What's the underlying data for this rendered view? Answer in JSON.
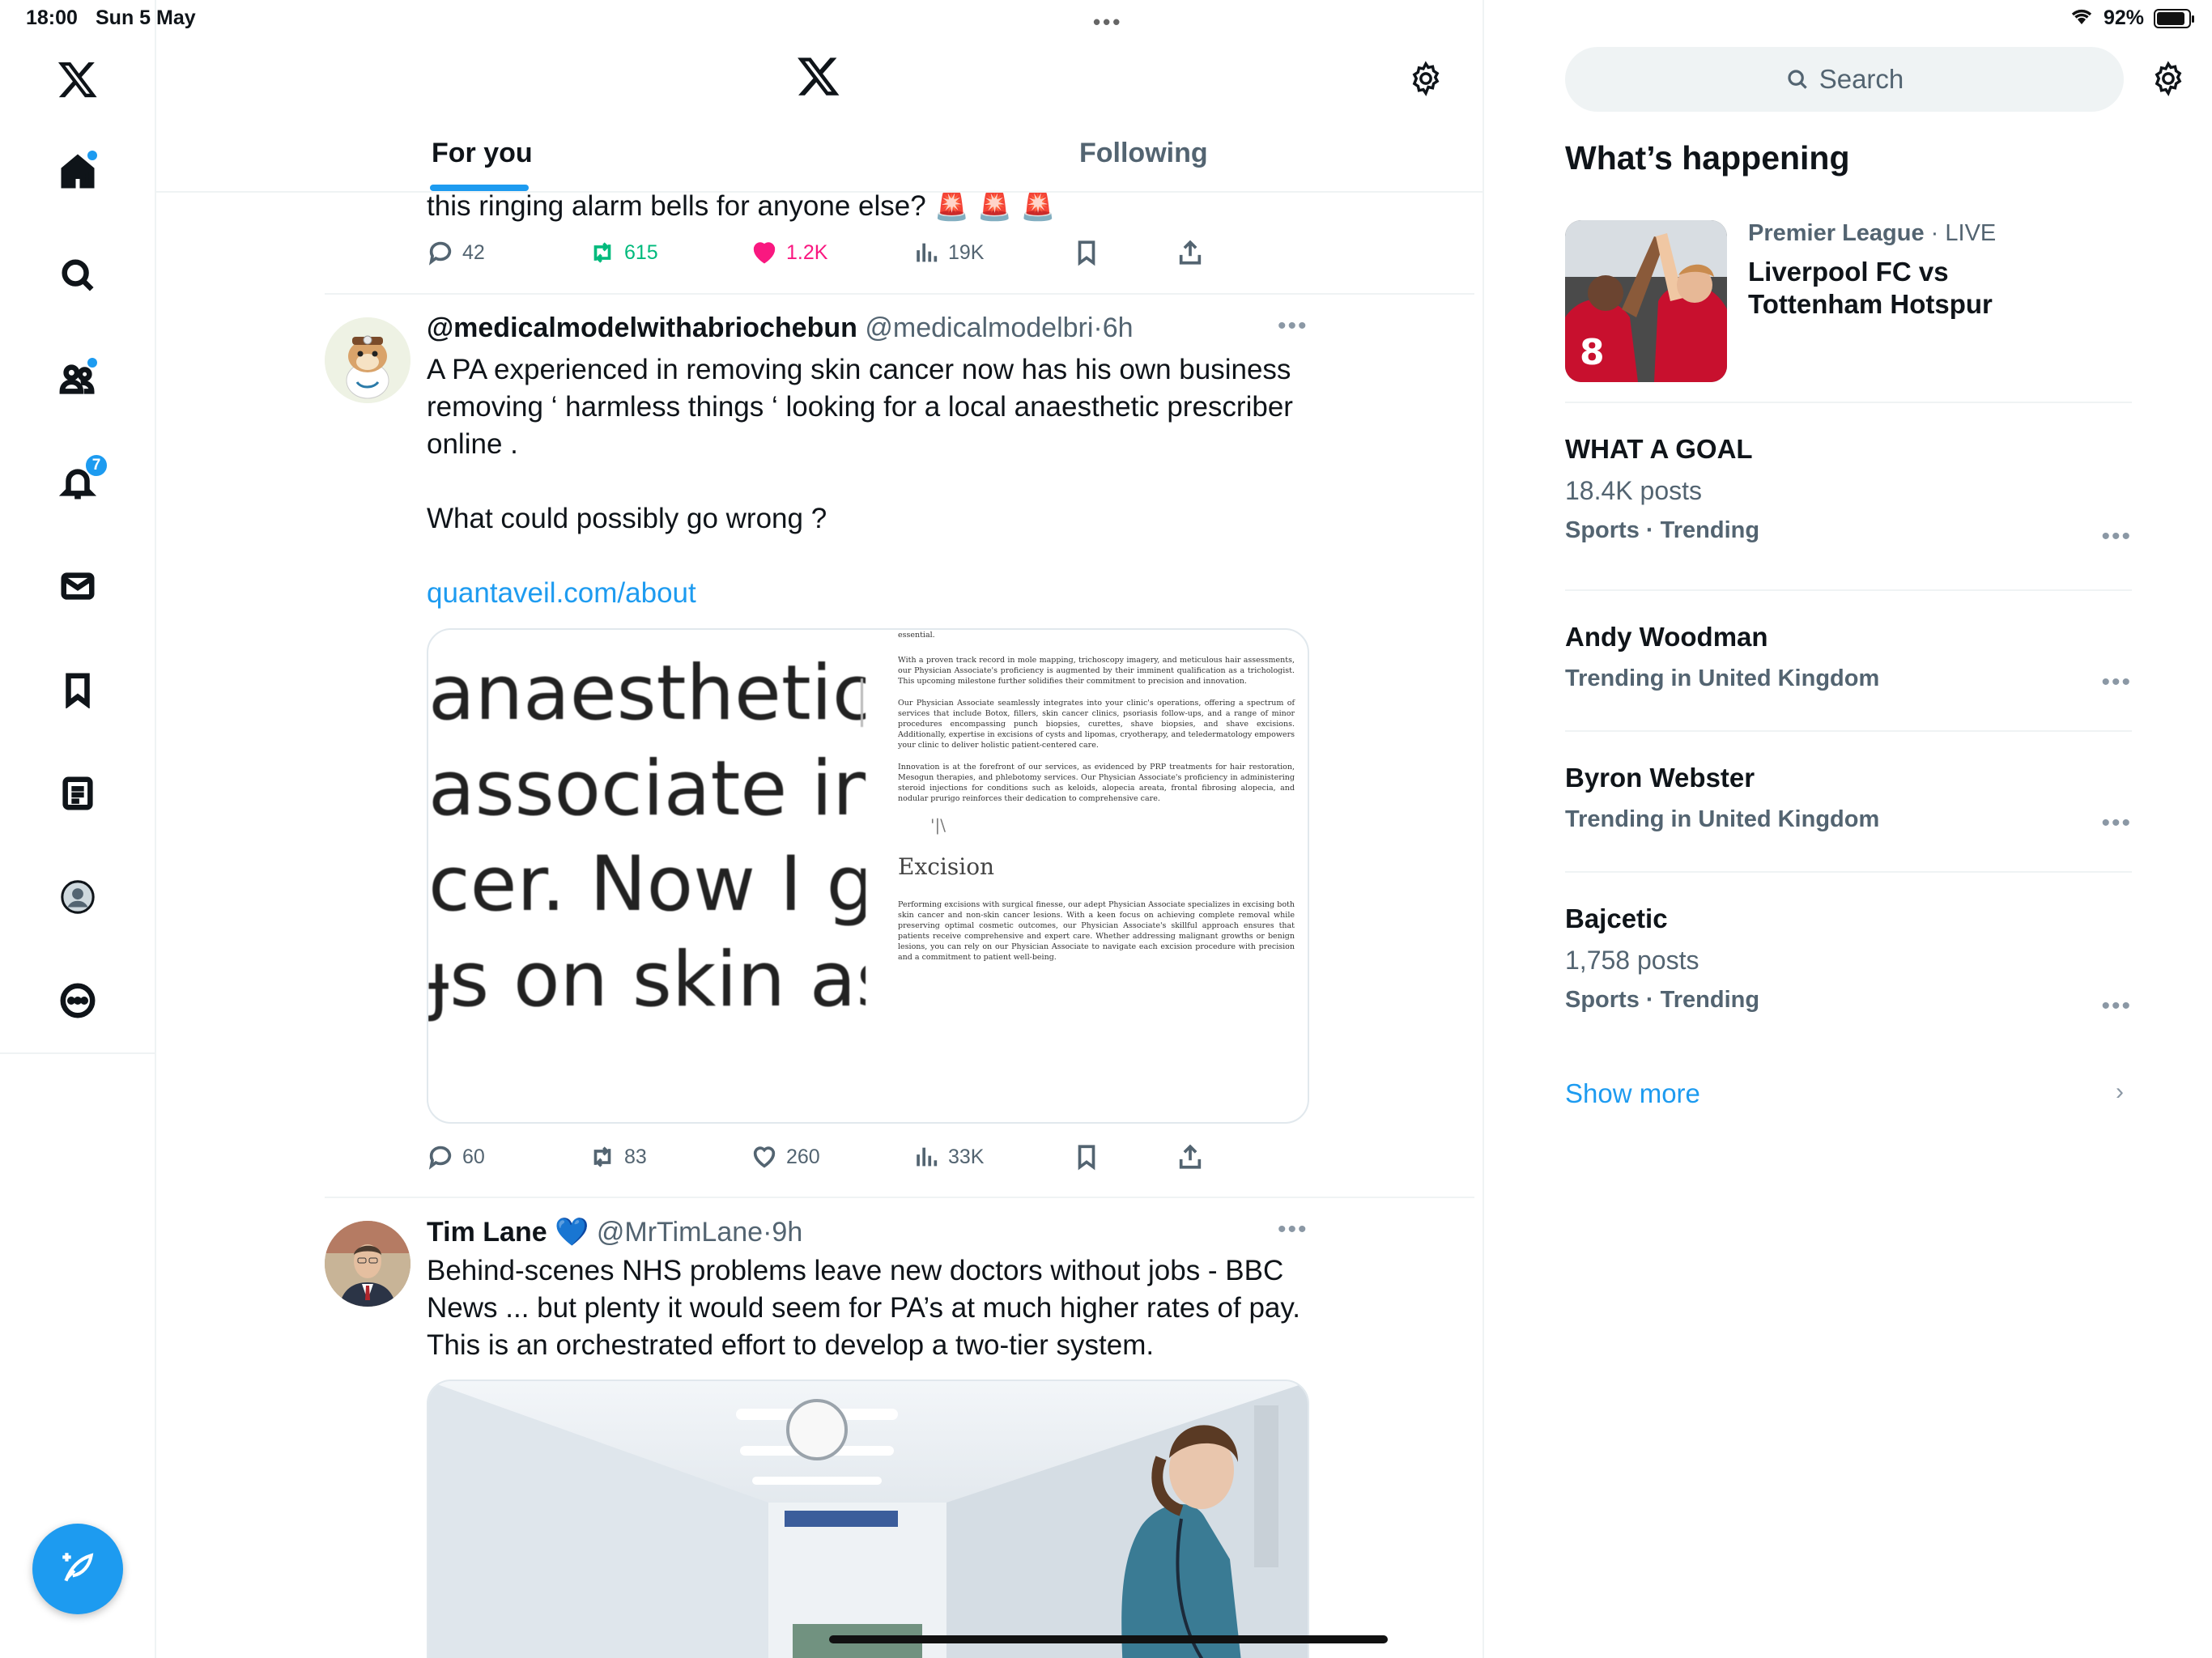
{
  "status_bar": {
    "time": "18:00",
    "date": "Sun 5 May",
    "battery": "92%"
  },
  "header": {
    "tabs": [
      {
        "label": "For you"
      },
      {
        "label": "Following"
      }
    ]
  },
  "nav": {
    "notifications_badge": "7"
  },
  "tweets": [
    {
      "text": "this ringing alarm bells for anyone else? 🚨 🚨 🚨",
      "replies": "42",
      "retweets": "615",
      "likes": "1.2K",
      "views": "19K"
    },
    {
      "name": "@medicalmodelwithabriochebun",
      "handle": "@medicalmodelbri",
      "time": "6h",
      "text_lines": [
        "A PA experienced in removing skin cancer now has his own business",
        "removing ‘ harmless things ‘ looking for a local anaesthetic prescriber",
        "online  .",
        "What could possibly go wrong ?"
      ],
      "link": "quantaveil.com/about",
      "image": {
        "big_lines": [
          "anaesthetic",
          "associate in",
          "cer. Now I gc",
          "ɟs on skin as"
        ],
        "doc_heading": "Excision",
        "doc_top": "essential.",
        "doc_p1": "With a proven track record in mole mapping, trichoscopy imagery, and meticulous hair assessments, our Physician Associate's proficiency is augmented by their imminent qualification as a trichologist. This upcoming milestone further solidifies their commitment to precision and innovation.",
        "doc_p2": "Our Physician Associate seamlessly integrates into your clinic's operations, offering a spectrum of services that include Botox, fillers, skin cancer clinics, psoriasis follow-ups, and a range of minor procedures encompassing punch biopsies, curettes, shave biopsies, and shave excisions. Additionally, expertise in excisions of cysts and lipomas, cryotherapy, and teledermatology empowers your clinic to deliver holistic patient-centered care.",
        "doc_p3": "Innovation is at the forefront of our services, as evidenced by PRP treatments for hair restoration, Mesogun therapies, and phlebotomy services. Our Physician Associate's proficiency in administering steroid injections for conditions such as keloids, alopecia areata, frontal fibrosing alopecia, and nodular prurigo reinforces their dedication to comprehensive care.",
        "doc_p4": "Performing excisions with surgical finesse, our adept Physician Associate specializes in excising both skin cancer and non-skin cancer lesions. With a keen focus on achieving complete removal while preserving optimal cosmetic outcomes, our Physician Associate's skillful approach ensures that patients receive comprehensive and expert care. Whether addressing malignant growths or benign lesions, you can rely on our Physician Associate to navigate each excision procedure with precision and a commitment to patient well-being."
      },
      "replies": "60",
      "retweets": "83",
      "likes": "260",
      "views": "33K"
    },
    {
      "name": "Tim Lane",
      "emoji": "💙",
      "handle": "@MrTimLane",
      "time": "9h",
      "text_lines": [
        "Behind-scenes NHS problems leave new doctors without jobs - BBC",
        "News ... but plenty it would seem for PA’s at much higher rates of pay.",
        "This is an orchestrated effort to develop a two-tier system."
      ]
    }
  ],
  "sidebar": {
    "search_placeholder": "Search",
    "whats_happening": "What’s happening",
    "live": {
      "category": "Premier League",
      "live": "LIVE",
      "title": "Liverpool FC vs Tottenham Hotspur"
    },
    "trends": [
      {
        "title": "WHAT A GOAL",
        "posts": "18.4K posts",
        "context": "Sports · Trending"
      },
      {
        "title": "Andy Woodman",
        "context": "Trending in United Kingdom"
      },
      {
        "title": "Byron Webster",
        "context": "Trending in United Kingdom"
      },
      {
        "title": "Bajcetic",
        "posts": "1,758 posts",
        "context": "Sports · Trending"
      }
    ],
    "show_more": "Show more"
  },
  "colors": {
    "accent": "#1d9bf0",
    "retweet": "#00ba7c",
    "like": "#f91880",
    "secondary_text": "#536471"
  }
}
